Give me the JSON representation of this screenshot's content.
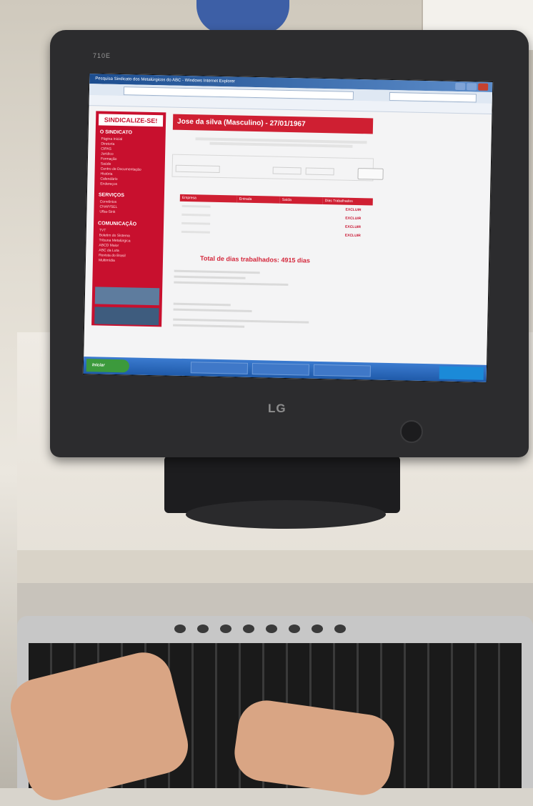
{
  "monitor": {
    "model": "710E",
    "brand": "LG"
  },
  "browser": {
    "window_title": "Pesquisa Sindicato dos Metalúrgicos do ABC - Windows Internet Explorer"
  },
  "sidebar": {
    "logo": "SINDICALIZE-SE!",
    "sections": [
      {
        "heading": "O SINDICATO",
        "items": [
          "Página Inicial",
          "Diretoria",
          "CIPAS",
          "Jurídico",
          "Formação",
          "Saúde",
          "Centro de Documentação",
          "História",
          "Calendário",
          "Endereços"
        ]
      },
      {
        "heading": "SERVIÇOS",
        "items": [
          "Convênios",
          "CNAP/SEL",
          "Ufba-Sink"
        ]
      },
      {
        "heading": "COMUNICAÇÃO",
        "items": [
          "TVT",
          "Boletim do Sistema",
          "Tribuna Metalúrgica",
          "ABCD Maior",
          "ABC da Luta",
          "Revista do Brasil",
          "Multimídia"
        ]
      }
    ]
  },
  "content": {
    "header": "Jose da silva (Masculino) - 27/01/1967",
    "table_headers": [
      "Empresa",
      "Entrada",
      "Saída",
      "Dias Trabalhados"
    ],
    "delete_label": "EXCLUIR",
    "total": "Total de dias trabalhados: 4915 dias"
  },
  "taskbar": {
    "start_label": "Iniciar"
  }
}
